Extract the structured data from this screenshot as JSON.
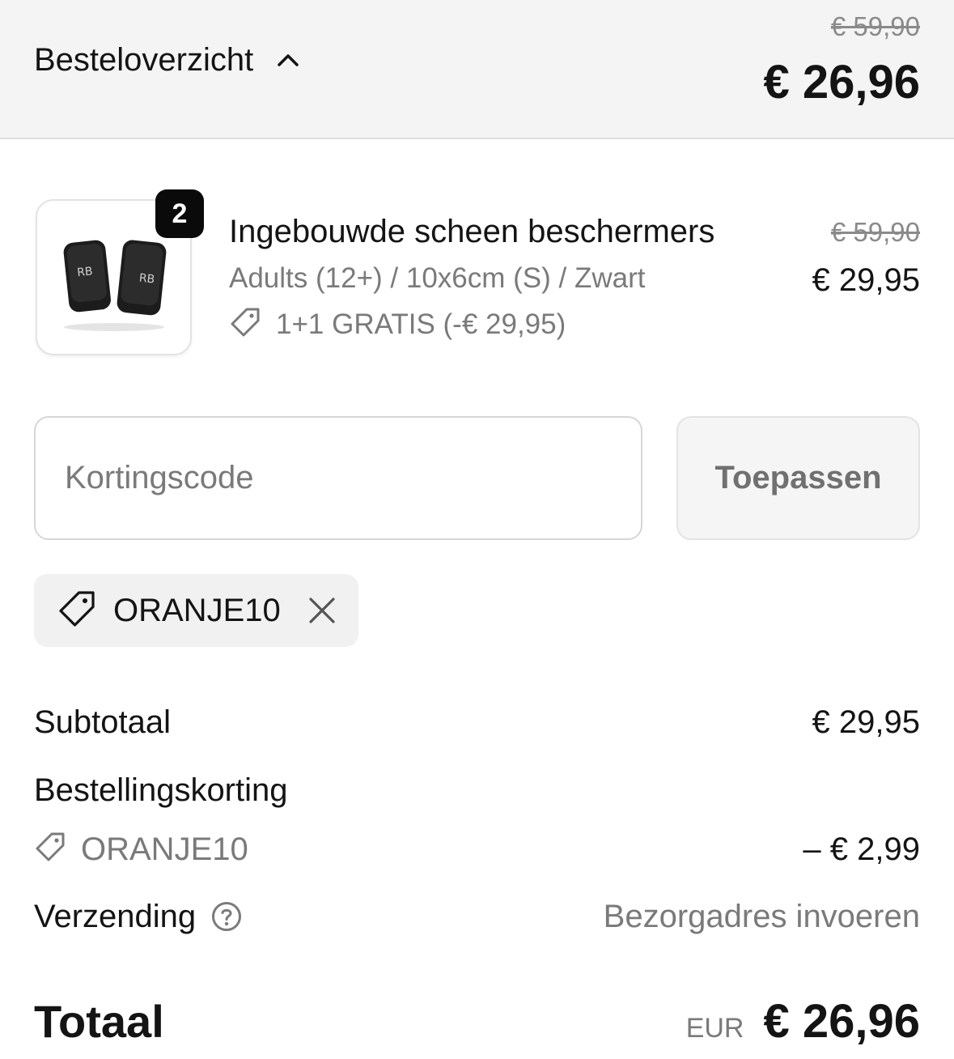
{
  "header": {
    "toggle_label": "Besteloverzicht",
    "old_total": "€ 59,90",
    "total": "€ 26,96"
  },
  "product": {
    "quantity": "2",
    "title": "Ingebouwde scheen beschermers",
    "variant": "Adults (12+) / 10x6cm (S) / Zwart",
    "promo": "1+1 GRATIS (-€ 29,95)",
    "old_price": "€ 59,90",
    "price": "€ 29,95"
  },
  "discount_form": {
    "placeholder": "Kortingscode",
    "value": "",
    "apply_label": "Toepassen"
  },
  "applied_code": {
    "code": "ORANJE10"
  },
  "summary": {
    "subtotal_label": "Subtotaal",
    "subtotal_value": "€ 29,95",
    "discount_title": "Bestellingskorting",
    "discount_code": "ORANJE10",
    "discount_value": "– € 2,99",
    "shipping_label": "Verzending",
    "shipping_value": "Bezorgadres invoeren",
    "total_label": "Totaal",
    "currency": "EUR",
    "total_value": "€ 26,96"
  },
  "icons": {
    "chevron": "chevron-up-icon",
    "tag": "tag-icon",
    "close": "close-icon",
    "help": "help-circle-icon"
  },
  "colors": {
    "text": "#141414",
    "muted": "#7a7a7a",
    "header_bg": "#f4f4f4",
    "badge_bg": "#0a0a0a"
  }
}
